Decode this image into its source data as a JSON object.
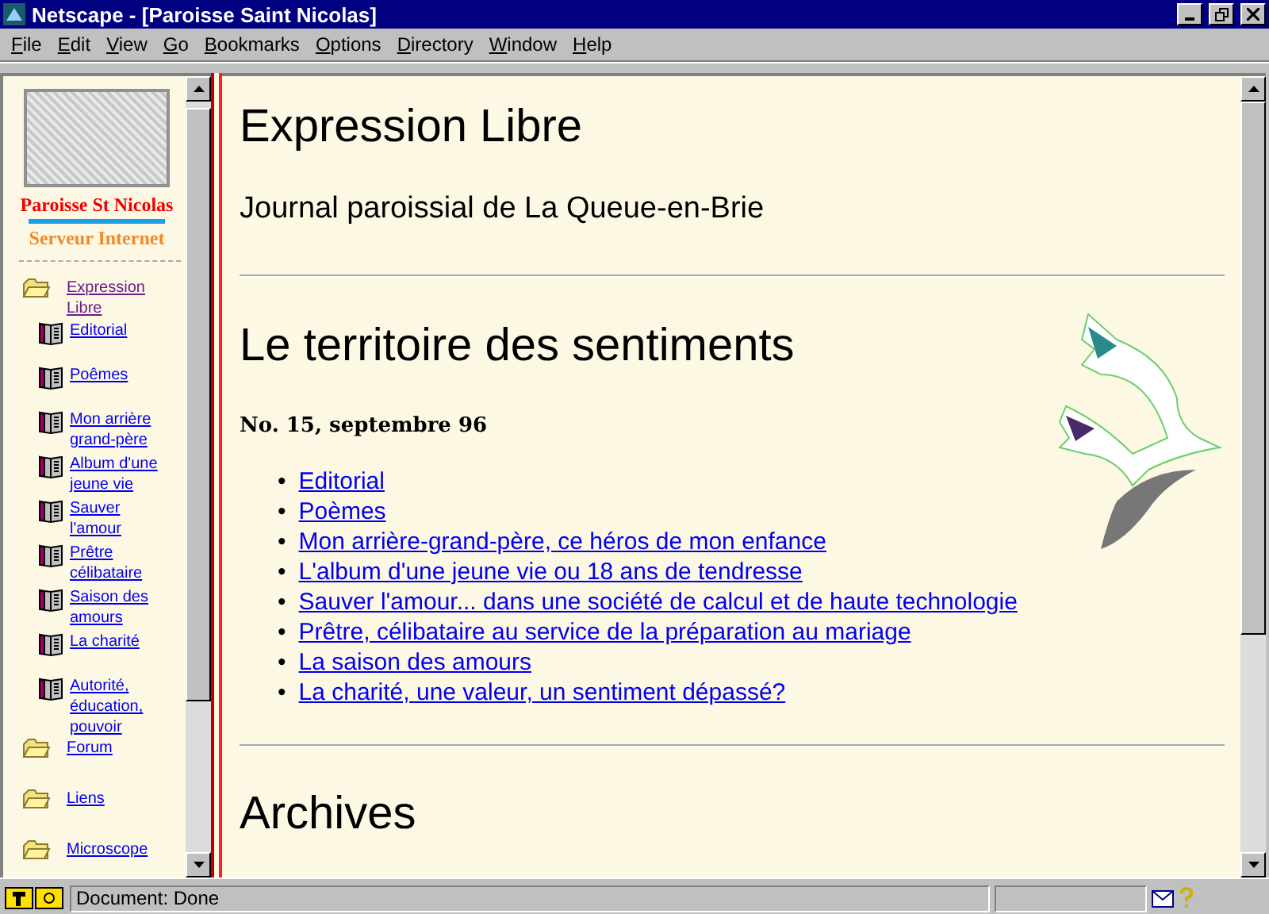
{
  "window": {
    "title": "Netscape - [Paroisse Saint Nicolas]"
  },
  "menu": [
    "File",
    "Edit",
    "View",
    "Go",
    "Bookmarks",
    "Options",
    "Directory",
    "Window",
    "Help"
  ],
  "sidebar": {
    "logo_title": "Paroisse St Nicolas",
    "logo_subtitle": "Serveur Internet",
    "items": [
      {
        "kind": "folder",
        "label": "Expression Libre",
        "visited": true
      },
      {
        "kind": "book",
        "label": "Editorial",
        "visited": false
      },
      {
        "kind": "book",
        "label": "Poêmes",
        "visited": false
      },
      {
        "kind": "book",
        "label": "Mon arrière grand-père",
        "visited": false
      },
      {
        "kind": "book",
        "label": "Album d'une jeune vie",
        "visited": false
      },
      {
        "kind": "book",
        "label": "Sauver l'amour",
        "visited": false
      },
      {
        "kind": "book",
        "label": "Prêtre célibataire",
        "visited": false
      },
      {
        "kind": "book",
        "label": "Saison des amours",
        "visited": false
      },
      {
        "kind": "book",
        "label": "La charité",
        "visited": false
      },
      {
        "kind": "book",
        "label": "Autorité, éducation, pouvoir",
        "visited": false
      },
      {
        "kind": "folder",
        "label": "Forum",
        "visited": false
      },
      {
        "kind": "folder",
        "label": "Liens",
        "visited": false
      },
      {
        "kind": "folder",
        "label": "Microscope",
        "visited": false
      }
    ]
  },
  "content": {
    "title": "Expression Libre",
    "subtitle": "Journal paroissial de La Queue-en-Brie",
    "heading": "Le territoire des sentiments",
    "issue": "No. 15, septembre 96",
    "links": [
      {
        "bullet": "•",
        "label": "Editorial"
      },
      {
        "bullet": "•",
        "label": "Poèmes"
      },
      {
        "bullet": "•",
        "label": "Mon arrière-grand-père, ce héros de mon enfance"
      },
      {
        "bullet": "•",
        "label": "L'album d'une jeune vie ou 18 ans de tendresse"
      },
      {
        "bullet": "•",
        "label": "Sauver l'amour... dans une société de calcul et de haute technologie"
      },
      {
        "bullet": "•",
        "label": "Prêtre, célibataire au service de la préparation au mariage"
      },
      {
        "bullet": "•",
        "label": "La saison des amours"
      },
      {
        "bullet": "•",
        "label": "La charité, une valeur, un sentiment dépassé?"
      }
    ],
    "section": "Archives"
  },
  "status_bar": {
    "text": "Document: Done"
  }
}
